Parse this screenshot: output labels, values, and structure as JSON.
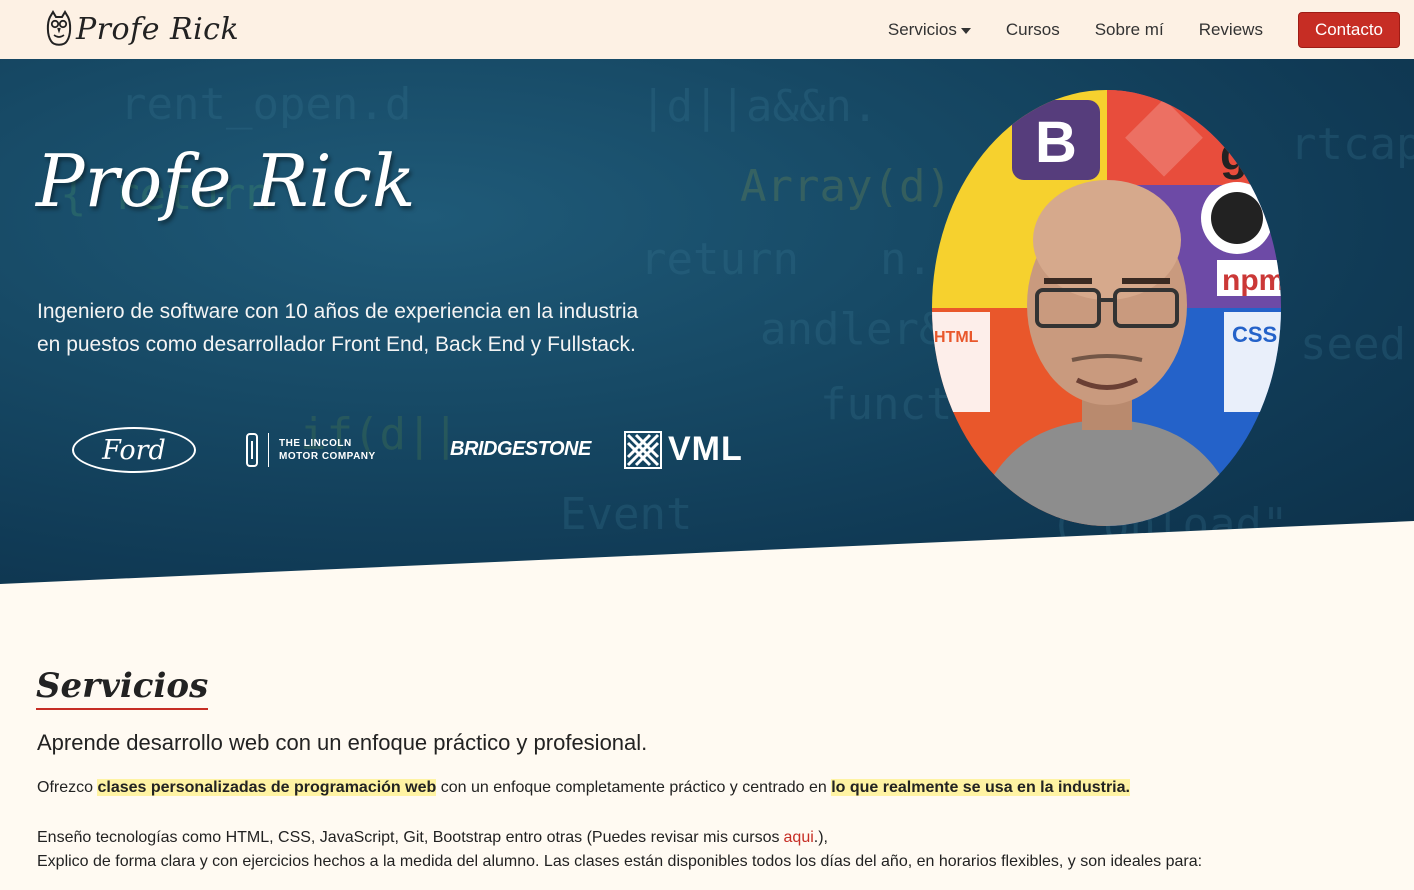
{
  "header": {
    "brand": "Profe Rick",
    "nav": [
      {
        "label": "Servicios",
        "has_dropdown": true
      },
      {
        "label": "Cursos"
      },
      {
        "label": "Sobre mí"
      },
      {
        "label": "Reviews"
      }
    ],
    "contact_label": "Contacto"
  },
  "hero": {
    "title": "Profe Rick",
    "subtitle_line1": "Ingeniero de software con 10 años de experiencia en la industria",
    "subtitle_line2": "en puestos como desarrollador Front End, Back End y Fullstack.",
    "company_logos": {
      "ford": "Ford",
      "lincoln": "THE LINCOLN\nMOTOR COMPANY",
      "bridgestone": "BRIDGESTONE",
      "vml": "VML"
    },
    "portrait_tiles": {
      "bootstrap": "B",
      "npm": "npm",
      "css": "CSS",
      "html": "HTML",
      "git": "g"
    }
  },
  "services": {
    "title": "Servicios",
    "lead": "Aprende desarrollo web con un enfoque práctico y profesional.",
    "p1_part1": "Ofrezco ",
    "p1_highlight1": "clases personalizadas de programación web",
    "p1_part2": " con un enfoque completamente práctico y centrado en ",
    "p1_highlight2": "lo que realmente se usa en la industria.",
    "p2_line1_part1": "Enseño tecnologías como HTML, CSS, JavaScript, Git, Bootstrap entro otras (Puedes revisar mis cursos",
    "p2_link": "aqui",
    "p2_line1_part2": ".),",
    "p2_line2": "Explico de forma clara y con ejercicios hechos a la medida del alumno. Las clases están disponibles todos los días del año, en horarios flexibles, y son ideales para:"
  },
  "colors": {
    "accent": "#c62d24",
    "header_bg": "#fdf1e4",
    "page_bg": "#fffaf2",
    "hero_bg": "#174a66",
    "highlight": "#fff3a3"
  }
}
